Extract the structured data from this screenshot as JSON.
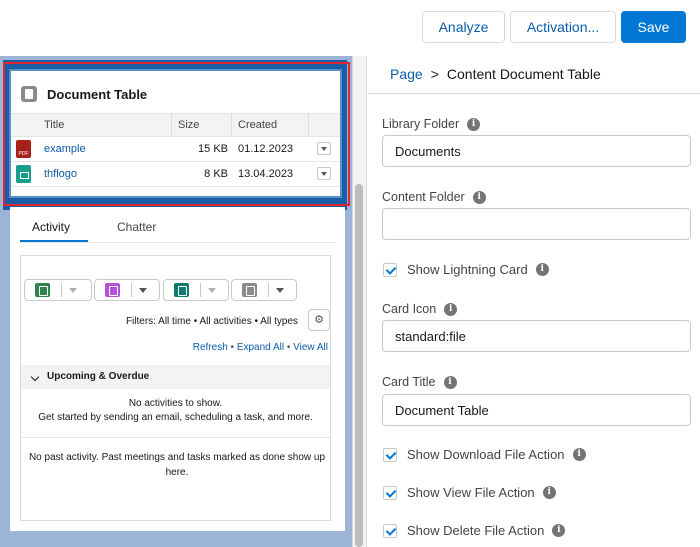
{
  "toolbar": {
    "analyze_label": "Analyze",
    "activation_label": "Activation...",
    "save_label": "Save",
    "accent_color": "#0176d3"
  },
  "document_table": {
    "title": "Document Table",
    "icon": "file-icon",
    "columns": [
      "Title",
      "Size",
      "Created"
    ],
    "rows": [
      {
        "icon": "pdf-file-icon",
        "icon_text": "PDF",
        "title": "example",
        "size": "15 KB",
        "created": "01.12.2023"
      },
      {
        "icon": "image-file-icon",
        "title": "thflogo",
        "size": "8 KB",
        "created": "13.04.2023"
      }
    ]
  },
  "activity": {
    "tabs": [
      "Activity",
      "Chatter"
    ],
    "publisher_icons": [
      "task-icon",
      "event-icon",
      "call-icon",
      "email-icon"
    ],
    "filters_text": "Filters: All time • All activities • All types",
    "links": {
      "refresh": "Refresh",
      "expand_all": "Expand All",
      "view_all": "View All"
    },
    "upcoming_label": "Upcoming & Overdue",
    "no_activities_line1": "No activities to show.",
    "no_activities_line2": "Get started by sending an email, scheduling a task, and more.",
    "no_past_text": "No past activity. Past meetings and tasks marked as done show up here."
  },
  "properties": {
    "breadcrumb": {
      "parent": "Page",
      "separator": ">",
      "current": "Content Document Table"
    },
    "library_folder": {
      "label": "Library Folder",
      "value": "Documents"
    },
    "content_folder": {
      "label": "Content Folder",
      "value": ""
    },
    "show_lightning_card": {
      "label": "Show Lightning Card",
      "checked": true
    },
    "card_icon": {
      "label": "Card Icon",
      "value": "standard:file"
    },
    "card_title": {
      "label": "Card Title",
      "value": "Document Table"
    },
    "show_download": {
      "label": "Show Download File Action",
      "checked": true
    },
    "show_view": {
      "label": "Show View File Action",
      "checked": true
    },
    "show_delete": {
      "label": "Show Delete File Action",
      "checked": true
    }
  }
}
